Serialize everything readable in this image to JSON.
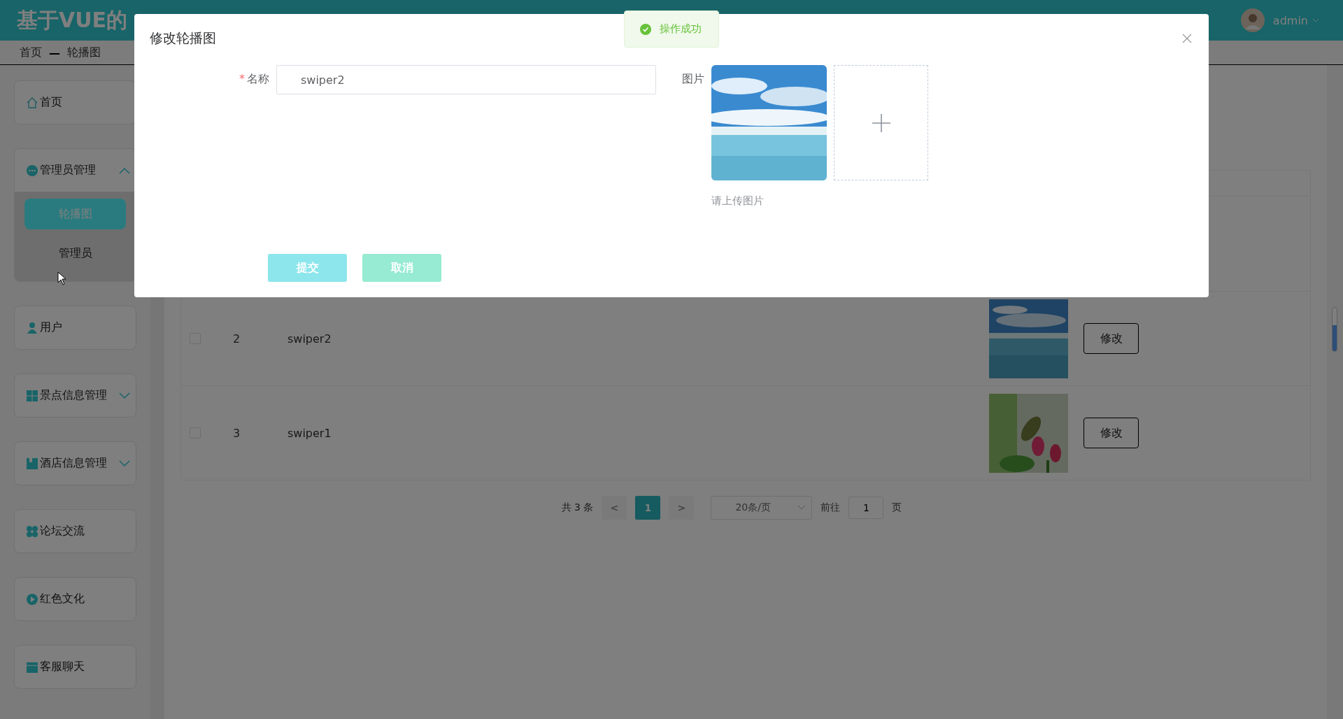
{
  "header": {
    "title": "基于VUE的",
    "user": "admin"
  },
  "breadcrumb": {
    "items": [
      "首页",
      "轮播图"
    ],
    "separator": "—"
  },
  "sidebar": [
    {
      "label": "首页",
      "kind": "link"
    },
    {
      "label": "管理员管理",
      "kind": "group",
      "expanded": true,
      "children": [
        {
          "label": "轮播图",
          "selected": true
        },
        {
          "label": "管理员",
          "selected": false
        }
      ]
    },
    {
      "label": "用户",
      "kind": "link"
    },
    {
      "label": "景点信息管理",
      "kind": "group",
      "expanded": false
    },
    {
      "label": "酒店信息管理",
      "kind": "group",
      "expanded": false
    },
    {
      "label": "论坛交流",
      "kind": "link"
    },
    {
      "label": "红色文化",
      "kind": "link"
    },
    {
      "label": "客服聊天",
      "kind": "link"
    }
  ],
  "table": {
    "rows": [
      {
        "index": "2",
        "name": "swiper2",
        "checked": false,
        "action": "修改"
      },
      {
        "index": "3",
        "name": "swiper1",
        "checked": false,
        "action": "修改"
      }
    ]
  },
  "pagination": {
    "total": "共 3 条",
    "prev": "<",
    "pages": [
      {
        "label": "1",
        "selected": true
      }
    ],
    "next": ">",
    "page_size": "20条/页",
    "goto_label": "前往",
    "goto_value": "1",
    "goto_suffix": "页"
  },
  "dialog": {
    "title": "修改轮播图",
    "fields": [
      {
        "kind": "text",
        "label": "名称",
        "required": true,
        "required_mark": "*",
        "value": "swiper2"
      },
      {
        "label": "图片",
        "hint": "请上传图片"
      }
    ],
    "buttons": [
      {
        "label": "提交",
        "kind": "primary"
      },
      {
        "label": "取消",
        "kind": "secondary"
      }
    ]
  },
  "toast": {
    "kind": "success",
    "message": "操作成功"
  }
}
